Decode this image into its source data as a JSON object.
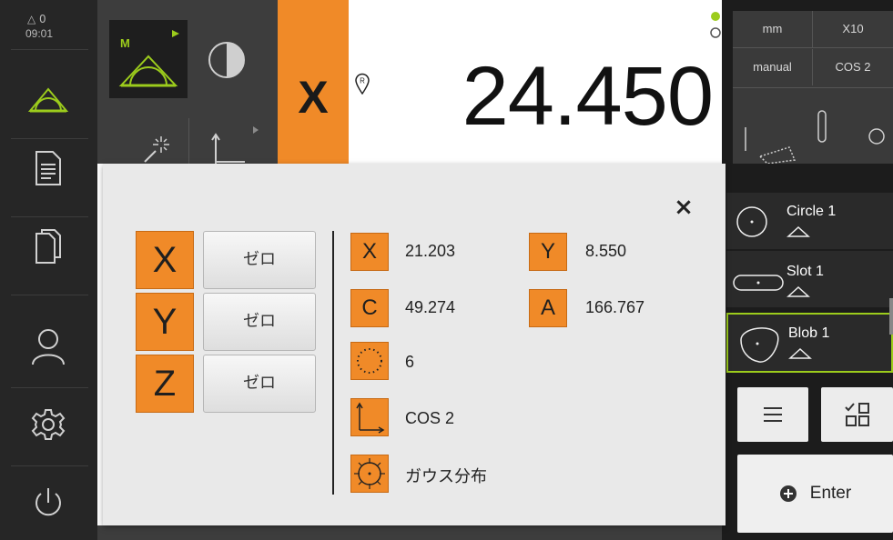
{
  "sidebar": {
    "status_warning": "△ 0",
    "time": "09:01",
    "items": [
      {
        "name": "measure-icon"
      },
      {
        "name": "report-icon"
      },
      {
        "name": "files-icon"
      },
      {
        "name": "user-icon"
      },
      {
        "name": "settings-icon"
      },
      {
        "name": "power-icon"
      }
    ]
  },
  "toolbar": {
    "mode_letter": "M"
  },
  "position": {
    "axis": "X",
    "value": "24.450"
  },
  "right_panel": {
    "unit": "mm",
    "zoom": "X10",
    "mode": "manual",
    "coord_system": "COS 2",
    "features": [
      {
        "label": "Circle 1"
      },
      {
        "label": "Slot 1"
      },
      {
        "label": "Blob 1"
      }
    ],
    "enter_label": "Enter"
  },
  "dialog": {
    "close": "×",
    "axes": [
      {
        "axis": "X",
        "zero": "ゼロ"
      },
      {
        "axis": "Y",
        "zero": "ゼロ"
      },
      {
        "axis": "Z",
        "zero": "ゼロ"
      }
    ],
    "results": {
      "x_label": "X",
      "x_value": "21.203",
      "y_label": "Y",
      "y_value": "8.550",
      "c_label": "C",
      "c_value": "49.274",
      "a_label": "A",
      "a_value": "166.767",
      "points": "6",
      "cos": "COS 2",
      "fit": "ガウス分布"
    }
  },
  "colors": {
    "accent_orange": "#f08a28",
    "accent_green": "#9ccc1c",
    "sidebar_bg": "#262626",
    "dialog_bg": "#e9e9e9"
  }
}
